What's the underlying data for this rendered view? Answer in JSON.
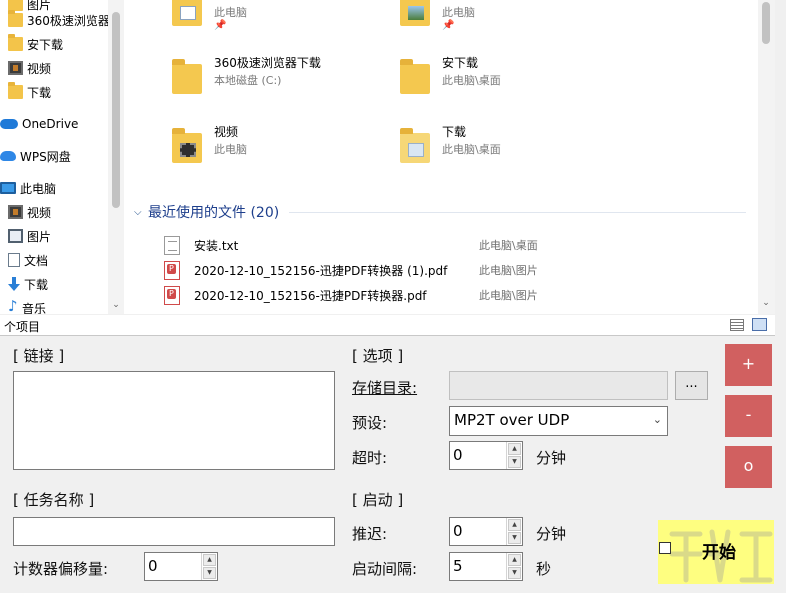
{
  "explorer": {
    "nav": [
      {
        "label": "图片",
        "icon": "folder-icon"
      },
      {
        "label": "360极速浏览器",
        "icon": "folder-icon"
      },
      {
        "label": "安下载",
        "icon": "folder-icon"
      },
      {
        "label": "视频",
        "icon": "video-folder-icon"
      },
      {
        "label": "下载",
        "icon": "folder-icon"
      },
      {
        "label": "OneDrive",
        "icon": "onedrive-cloud-icon"
      },
      {
        "label": "WPS网盘",
        "icon": "wps-cloud-icon"
      },
      {
        "label": "此电脑",
        "icon": "computer-icon"
      },
      {
        "label": "视频",
        "icon": "video-folder-icon"
      },
      {
        "label": "图片",
        "icon": "pictures-icon"
      },
      {
        "label": "文档",
        "icon": "documents-icon"
      },
      {
        "label": "下载",
        "icon": "download-icon"
      },
      {
        "label": "音乐",
        "icon": "music-icon"
      }
    ],
    "quick_access": [
      {
        "name": "",
        "location": "此电脑",
        "pinned": true,
        "icon": "documents-folder-icon"
      },
      {
        "name": "",
        "location": "此电脑",
        "pinned": true,
        "icon": "pictures-folder-icon"
      },
      {
        "name": "360极速浏览器下载",
        "location": "本地磁盘 (C:)",
        "pinned": false,
        "icon": "folder-icon"
      },
      {
        "name": "安下载",
        "location": "此电脑\\桌面",
        "pinned": false,
        "icon": "folder-icon"
      },
      {
        "name": "视频",
        "location": "此电脑",
        "pinned": false,
        "icon": "video-folder-icon"
      },
      {
        "name": "下载",
        "location": "此电脑\\桌面",
        "pinned": false,
        "icon": "open-folder-icon"
      }
    ],
    "recent": {
      "title": "最近使用的文件 (20)",
      "files": [
        {
          "name": "安装.txt",
          "path": "此电脑\\桌面",
          "type": "txt"
        },
        {
          "name": "2020-12-10_152156-迅捷PDF转换器 (1).pdf",
          "path": "此电脑\\图片",
          "type": "pdf"
        },
        {
          "name": "2020-12-10_152156-迅捷PDF转换器.pdf",
          "path": "此电脑\\图片",
          "type": "pdf"
        }
      ]
    },
    "status": "个项目"
  },
  "app": {
    "link_label": "[ 链接 ]",
    "link_value": "",
    "task_label": "[ 任务名称 ]",
    "task_value": "",
    "counter_label": "计数器偏移量:",
    "counter_value": "0",
    "options_label": "[ 选项 ]",
    "dir_label": "存储目录:",
    "dir_value": "",
    "browse_label": "...",
    "preset_label": "预设:",
    "preset_value": "MP2T over UDP",
    "timeout_label": "超时:",
    "timeout_value": "0",
    "timeout_unit": "分钟",
    "start_section_label": "[ 启动 ]",
    "delay_label": "推迟:",
    "delay_value": "0",
    "delay_unit": "分钟",
    "interval_label": "启动间隔:",
    "interval_value": "5",
    "interval_unit": "秒",
    "add_label": "+",
    "remove_label": "-",
    "reset_label": "o",
    "start_label": "开始"
  },
  "colors": {
    "red_button": "#d16060",
    "start_highlight": "#fefe80",
    "recent_header": "#1e3f8c"
  }
}
